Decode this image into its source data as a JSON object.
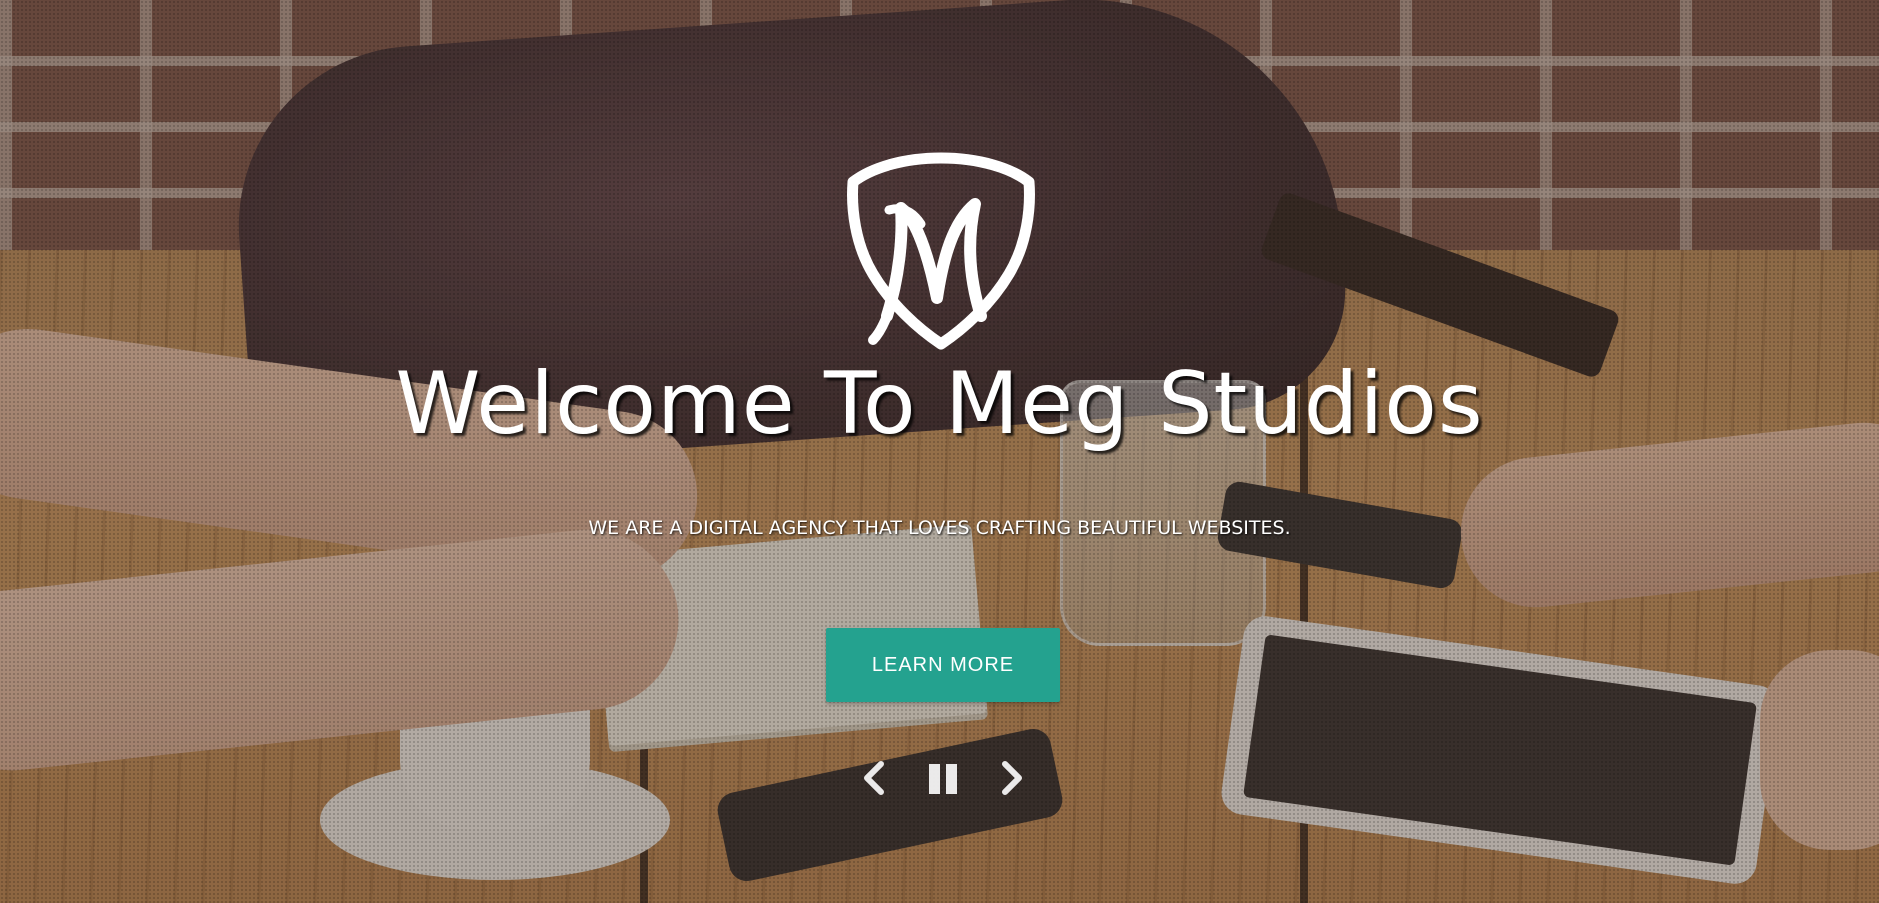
{
  "hero": {
    "title": "Welcome To Meg Studios",
    "subtitle": "WE ARE A DIGITAL AGENCY THAT LOVES CRAFTING BEAUTIFUL WEBSITES.",
    "cta_label": "LEARN MORE",
    "logo_icon": "meg-studios-shield-logo",
    "background_image": "people-at-cafe-table-photo"
  },
  "carousel_controls": {
    "prev_icon": "chevron-left-icon",
    "pause_icon": "pause-icon",
    "next_icon": "chevron-right-icon"
  },
  "colors": {
    "accent": "#24a28f",
    "text": "#ffffff"
  }
}
